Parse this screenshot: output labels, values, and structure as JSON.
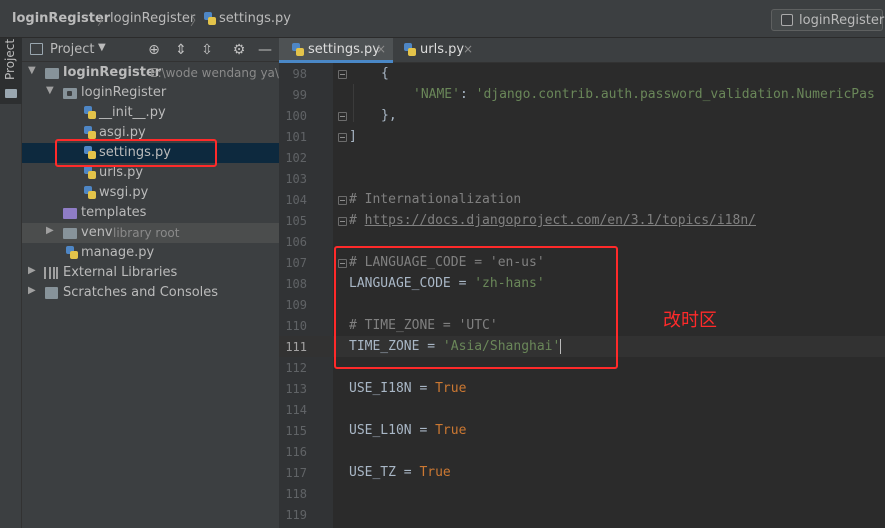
{
  "breadcrumb": {
    "project": "loginRegister",
    "package": "loginRegister",
    "file": "settings.py"
  },
  "run_config": {
    "label": "loginRegister"
  },
  "tool_strip": {
    "label": "Project"
  },
  "project_panel": {
    "title": "Project",
    "tree": [
      {
        "label": "loginRegister",
        "hint": "E:\\wode wendang ya\\",
        "kind": "root"
      },
      {
        "label": "loginRegister",
        "kind": "package"
      },
      {
        "label": "__init__.py",
        "kind": "py"
      },
      {
        "label": "asgi.py",
        "kind": "py"
      },
      {
        "label": "settings.py",
        "kind": "py",
        "selected": true
      },
      {
        "label": "urls.py",
        "kind": "py"
      },
      {
        "label": "wsgi.py",
        "kind": "py"
      },
      {
        "label": "templates",
        "kind": "folder"
      },
      {
        "label": "venv",
        "hint": "library root",
        "kind": "folder"
      },
      {
        "label": "manage.py",
        "kind": "py"
      },
      {
        "label": "External Libraries",
        "kind": "lib"
      },
      {
        "label": "Scratches and Consoles",
        "kind": "scratch"
      }
    ]
  },
  "tabs": [
    {
      "label": "settings.py",
      "active": true
    },
    {
      "label": "urls.py",
      "active": false
    }
  ],
  "editor": {
    "current_line": "111",
    "lines": [
      {
        "n": "98",
        "text": "        {"
      },
      {
        "n": "99",
        "text": "            'NAME': 'django.contrib.auth.password_validation.NumericPas"
      },
      {
        "n": "100",
        "text": "        },"
      },
      {
        "n": "101",
        "text": "]"
      },
      {
        "n": "102",
        "text": ""
      },
      {
        "n": "103",
        "text": ""
      },
      {
        "n": "104",
        "text": "# Internationalization"
      },
      {
        "n": "105",
        "text": "# https://docs.djangoproject.com/en/3.1/topics/i18n/"
      },
      {
        "n": "106",
        "text": ""
      },
      {
        "n": "107",
        "text": "# LANGUAGE_CODE = 'en-us'"
      },
      {
        "n": "108",
        "text": "LANGUAGE_CODE = 'zh-hans'"
      },
      {
        "n": "109",
        "text": ""
      },
      {
        "n": "110",
        "text": "# TIME_ZONE = 'UTC'"
      },
      {
        "n": "111",
        "text": "TIME_ZONE = 'Asia/Shanghai'"
      },
      {
        "n": "112",
        "text": ""
      },
      {
        "n": "113",
        "text": "USE_I18N = True"
      },
      {
        "n": "114",
        "text": ""
      },
      {
        "n": "115",
        "text": "USE_L10N = True"
      },
      {
        "n": "116",
        "text": ""
      },
      {
        "n": "117",
        "text": "USE_TZ = True"
      },
      {
        "n": "118",
        "text": ""
      },
      {
        "n": "119",
        "text": ""
      }
    ],
    "tokens": {
      "l98": "{",
      "l99_key": "'NAME'",
      "l99_colon": ": ",
      "l99_val": "'django.contrib.auth.password_validation.NumericPas",
      "l100": "},",
      "l101": "]",
      "l104": "# Internationalization",
      "l105_hash": "# ",
      "l105_link": "https://docs.djangoproject.com/en/3.1/topics/i18n/",
      "l107": "# LANGUAGE_CODE = 'en-us'",
      "l108_name": "LANGUAGE_CODE = ",
      "l108_val": "'zh-hans'",
      "l110": "# TIME_ZONE = 'UTC'",
      "l111_name": "TIME_ZONE = ",
      "l111_val": "'Asia/Shanghai'",
      "l113_name": "USE_I18N = ",
      "l115_name": "USE_L10N = ",
      "l117_name": "USE_TZ = ",
      "true_kw": "True"
    }
  },
  "annotation": {
    "text": "改时区"
  },
  "colors": {
    "highlight": "#ff2a2a",
    "background": "#2b2b2b",
    "panel": "#3c3f41",
    "string": "#6a8759",
    "keyword": "#cc7832",
    "comment": "#808080"
  }
}
